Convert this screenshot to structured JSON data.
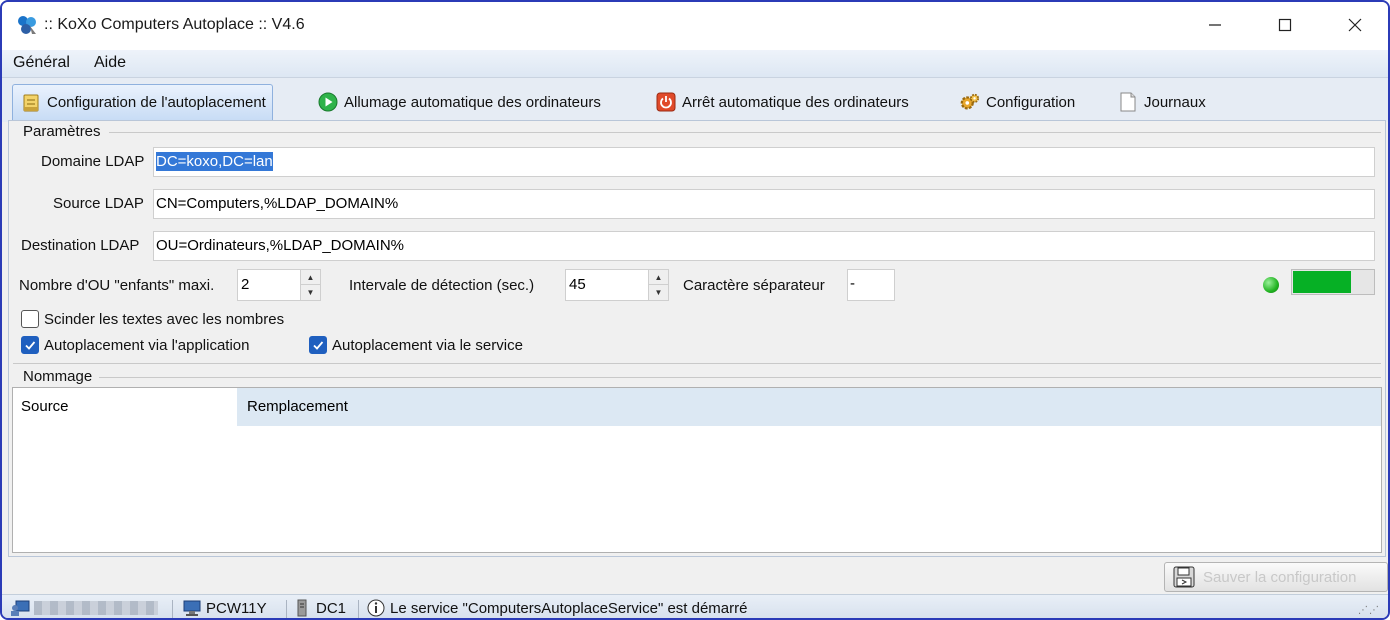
{
  "window": {
    "title": ":: KoXo Computers Autoplace :: V4.6",
    "controls": {
      "minimize": "—",
      "maximize": "☐",
      "close": "✕"
    }
  },
  "menu": {
    "general": "Général",
    "aide": "Aide"
  },
  "tabs": [
    {
      "label": "Configuration de l'autoplacement",
      "icon": "config-doc-icon",
      "active": true
    },
    {
      "label": "Allumage automatique des ordinateurs",
      "icon": "play-green-icon"
    },
    {
      "label": "Arrêt automatique des ordinateurs",
      "icon": "power-red-icon"
    },
    {
      "label": "Configuration",
      "icon": "gears-icon"
    },
    {
      "label": "Journaux",
      "icon": "document-icon"
    }
  ],
  "parametres": {
    "title": "Paramètres",
    "domaine_label": "Domaine LDAP",
    "domaine_value": "DC=koxo,DC=lan",
    "source_label": "Source LDAP",
    "source_value": "CN=Computers,%LDAP_DOMAIN%",
    "destination_label": "Destination LDAP",
    "destination_value": "OU=Ordinateurs,%LDAP_DOMAIN%",
    "nombre_ou_label": "Nombre d'OU \"enfants\" maxi.",
    "nombre_ou_value": "2",
    "intervalle_label": "Intervale de détection (sec.)",
    "intervalle_value": "45",
    "separateur_label": "Caractère séparateur",
    "separateur_value": "-",
    "scinder_label": "Scinder les textes avec les nombres",
    "scinder_checked": false,
    "autoplace_app_label": "Autoplacement via l'application",
    "autoplace_app_checked": true,
    "autoplace_service_label": "Autoplacement via le service",
    "autoplace_service_checked": true,
    "status_led_color": "#22b422",
    "progress_fraction": 0.72,
    "progress_color": "#06b025"
  },
  "nommage": {
    "title": "Nommage",
    "columns": [
      "Source",
      "Remplacement"
    ]
  },
  "save_button": {
    "label": "Sauver la configuration",
    "enabled": false
  },
  "statusbar": {
    "computer": "PCW11Y",
    "server": "DC1",
    "message": "Le service \"ComputersAutoplaceService\" est démarré"
  }
}
